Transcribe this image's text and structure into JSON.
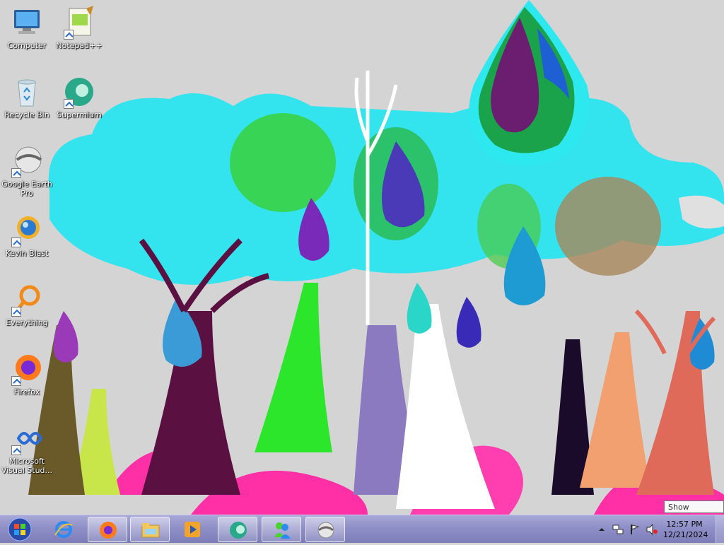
{
  "desktop": {
    "icons": [
      {
        "label": "Computer",
        "name": "computer-icon"
      },
      {
        "label": "Notepad++",
        "name": "notepad-plus-plus-icon"
      },
      {
        "label": "Recycle Bin",
        "name": "recycle-bin-icon"
      },
      {
        "label": "Supermium",
        "name": "supermium-icon"
      },
      {
        "label": "Google Earth Pro",
        "name": "google-earth-pro-icon"
      },
      {
        "label": "Kevin Blast",
        "name": "kevin-blast-icon"
      },
      {
        "label": "Everything",
        "name": "everything-icon"
      },
      {
        "label": "Firefox",
        "name": "firefox-icon"
      },
      {
        "label": "Microsoft Visual Stud...",
        "name": "visual-studio-icon"
      }
    ]
  },
  "taskbar": {
    "buttons": [
      "start-orb-icon",
      "internet-explorer-icon",
      "firefox-icon",
      "file-explorer-icon",
      "media-player-icon",
      "supermium-icon",
      "messenger-icon",
      "google-earth-pro-icon"
    ],
    "clock": {
      "time": "12:57 PM",
      "date": "12/21/2024"
    },
    "show_desktop_tooltip": "Show desktop"
  },
  "colors": {
    "taskbar": "#8f8fc8",
    "sky": "#d6d6d6",
    "cloud": "#33e3ee"
  }
}
